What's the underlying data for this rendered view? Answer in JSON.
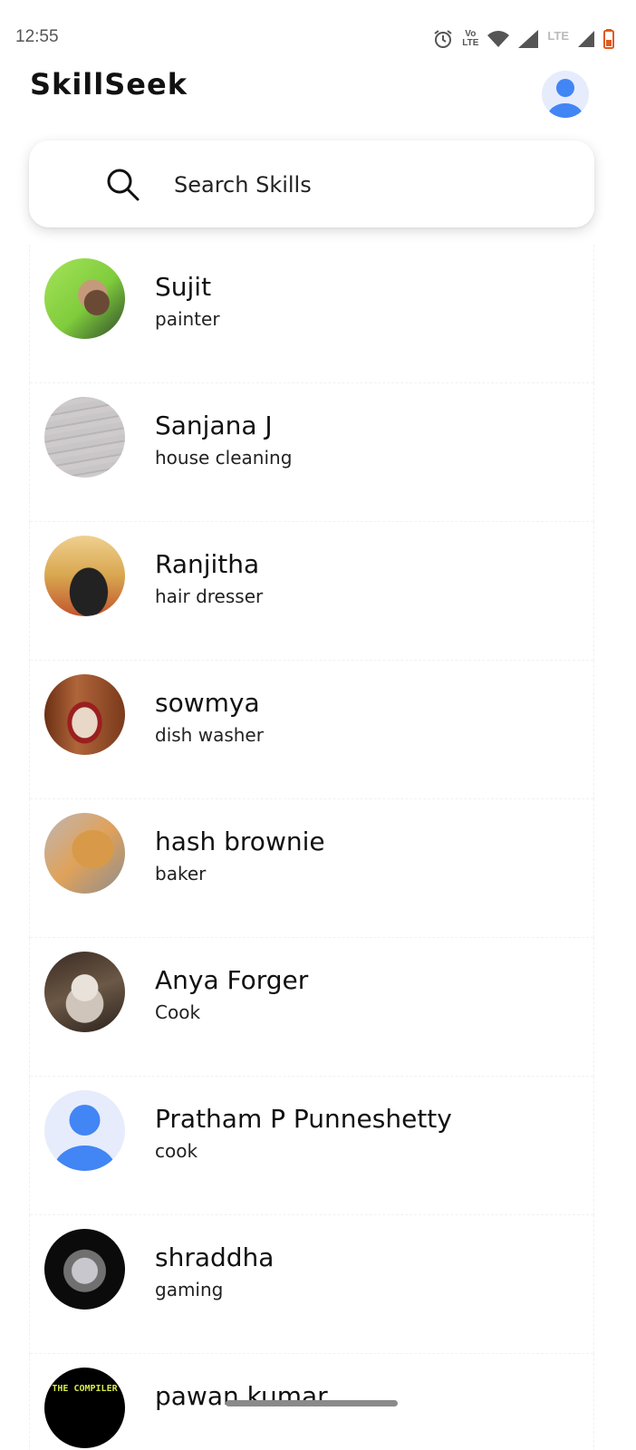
{
  "status_bar": {
    "time": "12:55",
    "volte_label_top": "Vo",
    "volte_label_bottom": "LTE",
    "lte_label": "LTE"
  },
  "header": {
    "title": "SkillSeek",
    "profile_icon": "user-avatar-icon"
  },
  "search": {
    "placeholder": "Search Skills",
    "icon": "search-icon"
  },
  "users": [
    {
      "name": "Sujit",
      "skill": "painter"
    },
    {
      "name": "Sanjana J",
      "skill": "house cleaning"
    },
    {
      "name": "Ranjitha",
      "skill": "hair dresser"
    },
    {
      "name": "sowmya",
      "skill": "dish washer"
    },
    {
      "name": "hash brownie",
      "skill": "baker"
    },
    {
      "name": "Anya Forger",
      "skill": "Cook"
    },
    {
      "name": "Pratham P Punneshetty",
      "skill": "cook"
    },
    {
      "name": "shraddha",
      "skill": "gaming"
    },
    {
      "name": "pawan kumar",
      "skill": ""
    }
  ],
  "avatar_texts": {
    "pawan": "THE COMPILER"
  },
  "colors": {
    "accent": "#4285f4",
    "avatar_bg": "#e6ecfb",
    "text": "#111111"
  }
}
